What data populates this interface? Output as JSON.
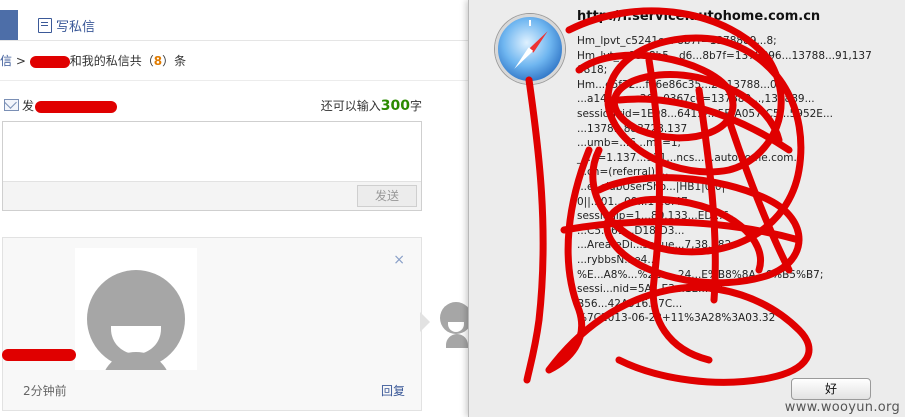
{
  "tabs": {
    "write_label": "写私信"
  },
  "breadcrumb": {
    "root": "信",
    "separator": " > ",
    "middle": "和我的私信共（",
    "count": "8",
    "suffix": "）条"
  },
  "compose": {
    "to_label": "发",
    "remain_prefix": "还可以输入",
    "remain_count": "300",
    "remain_suffix": "字",
    "send_label": "发送",
    "placeholder": ""
  },
  "message": {
    "time": "2分钟前",
    "reply_label": "回复",
    "close_glyph": "×"
  },
  "dialog": {
    "title": "http://i.service.autohome.com.cn",
    "cookie_text": "Hm_lpvt_c5241c... 8b7f=1378889...8;\nHm_lvt_...1958b5...d6...8b7f=1378896...13788...91,1378818;\nHm...e5f72...fe6e86c35...2=13788...0;\n...a14e...a...36...0367c0=137889...,137889...\nsessionvid=1E08...6415-...5E-A057-C5...5952E...\n...1378...883728.137\n...umb=...6...mc=1;\n__...=1.137...921...ncs...h.autohome.com.c\n...cn=(referral)|...\n...e; clubUserSho...|HB1|0|0|\n0||...01...09...1 18:47...\nsessionip=1...80.133...ED...6-\n...C5...69...D18-D3...\n...AreateDi...seque...7,38...82;\n...rybbsN...e4...\n%E...A8%...%2Ca...24...E%B8%8A...6%B5%B7;\nsessi...nid=5A...E3...1E...0D...\nB56...42A916...7C...\n%7C2013-06-22+11%3A28%3A03.32",
    "ok_label": "好"
  },
  "watermark": "www.wooyun.org",
  "colors": {
    "accent": "#3b5998",
    "tab_active": "#4d6ea8",
    "count": "#e07b00",
    "remain": "#2b8a00",
    "redaction": "#e00000"
  }
}
